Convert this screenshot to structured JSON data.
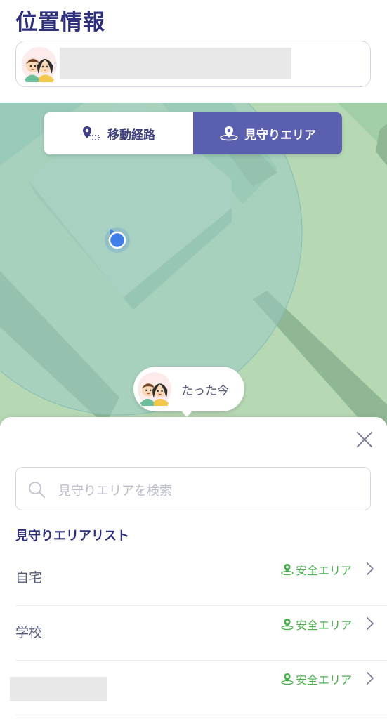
{
  "header": {
    "title": "位置情報"
  },
  "map_toggle": {
    "route_label": "移動経路",
    "area_label": "見守りエリア",
    "active": "area"
  },
  "location_bubble": {
    "time": "たった今"
  },
  "sheet": {
    "search_placeholder": "見守りエリアを検索",
    "list_title": "見守りエリアリスト",
    "areas": [
      {
        "name": "自宅",
        "status": "安全エリア"
      },
      {
        "name": "学校",
        "status": "安全エリア"
      },
      {
        "name": "",
        "status": "安全エリア"
      }
    ]
  },
  "colors": {
    "primary": "#5b5fb0",
    "title": "#2e2f7a",
    "safe_green": "#4caf50",
    "location_dot": "#3f7ee8"
  }
}
